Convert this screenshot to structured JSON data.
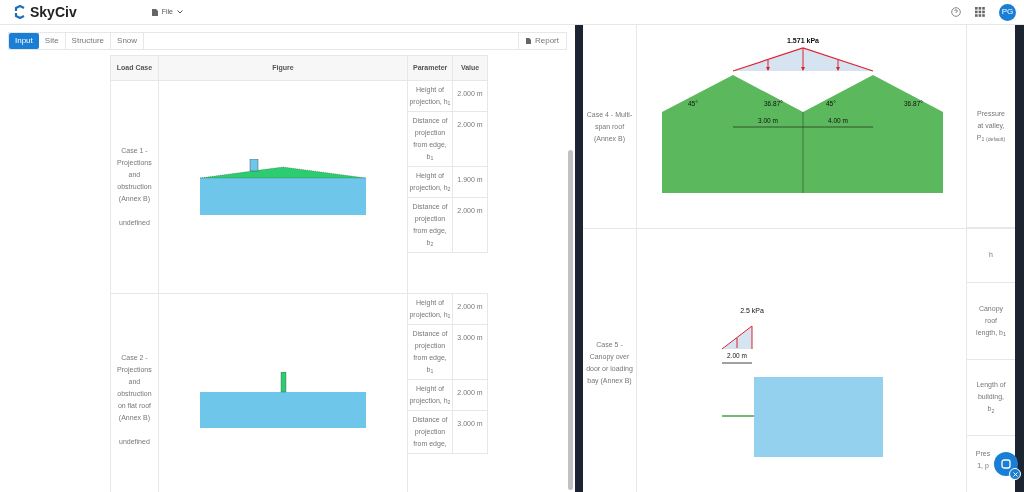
{
  "header": {
    "logo": "SkyCiv",
    "file_menu": "File",
    "avatar": "PG"
  },
  "tabs": [
    {
      "label": "Input",
      "selected": true
    },
    {
      "label": "Site",
      "selected": false
    },
    {
      "label": "Structure",
      "selected": false
    },
    {
      "label": "Snow",
      "selected": false
    }
  ],
  "report_button": "Report",
  "left_table": {
    "columns": [
      "Load Case",
      "Figure",
      "Parameter",
      "Value"
    ],
    "cases": [
      {
        "name": "Case 1 - Projections and obstruction (Annex B)",
        "note": "undefined",
        "figure": {
          "kind": "ridge"
        },
        "params": [
          {
            "parameter": "Height of projection, h$_{1}$",
            "value": "2.000 m"
          },
          {
            "parameter": "Distance of projection from edge, b$_{1}$",
            "value": "2.000 m"
          },
          {
            "parameter": "Height of projection, h$_{2}$",
            "value": "1.900 m"
          },
          {
            "parameter": "Distance of projection from edge, b$_{2}$",
            "value": "2.000 m"
          }
        ]
      },
      {
        "name": "Case 2 - Projections and obstruction on flat roof (Annex B)",
        "note": "undefined",
        "figure": {
          "kind": "flat"
        },
        "params": [
          {
            "parameter": "Height of projection, h$_{1}$",
            "value": "2.000 m"
          },
          {
            "parameter": "Distance of projection from edge, b$_{1}$",
            "value": "3.000 m"
          },
          {
            "parameter": "Height of projection, h$_{2}$",
            "value": "2.000 m"
          },
          {
            "parameter": "Distance of projection from edge,",
            "value": "3.000 m"
          }
        ]
      }
    ]
  },
  "right_table": {
    "cases": [
      {
        "name": "Case 4 - Multi-span roof (Annex B)",
        "figure": {
          "kind": "multispan",
          "load": "1.571 kPa",
          "angles": [
            "45°",
            "36.87°",
            "45°",
            "36.87°"
          ],
          "dims": [
            "3.00 m",
            "4.00 m"
          ]
        },
        "params": [
          "Pressure at valley, P$_{1 (default)}$"
        ]
      },
      {
        "name": "Case 5 - Canopy over door or loading bay (Annex B)",
        "figure": {
          "kind": "canopy",
          "load": "2.5 kPa",
          "dims": [
            "2.00 m"
          ]
        },
        "params": [
          "h",
          "Canopy roof length, b$_{1}$",
          "Length of building, b$_{2}$",
          "Pres 1, p"
        ]
      }
    ]
  }
}
